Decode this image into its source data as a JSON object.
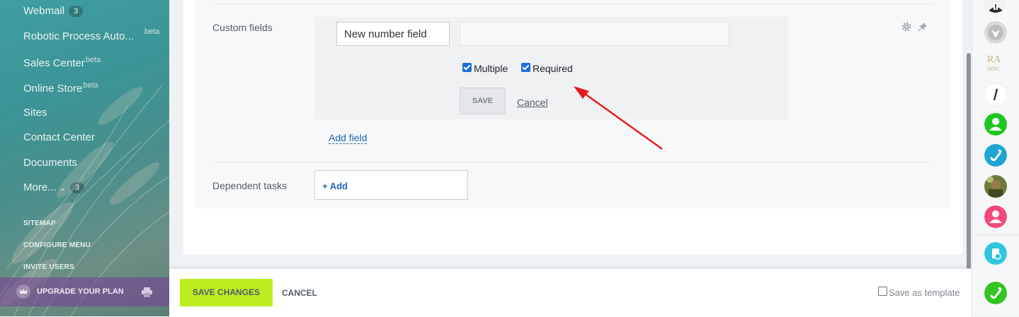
{
  "sidebar": {
    "items": [
      {
        "label": "Webmail",
        "counter": "3"
      },
      {
        "label": "Robotic Process Auto...",
        "badge": "beta"
      },
      {
        "label": "Sales Center",
        "badge": "beta"
      },
      {
        "label": "Online Store",
        "badge": "beta"
      },
      {
        "label": "Sites"
      },
      {
        "label": "Contact Center"
      },
      {
        "label": "Documents"
      },
      {
        "label": "More...",
        "counter": "3"
      }
    ],
    "small_links": [
      "SITEMAP",
      "CONFIGURE MENU",
      "INVITE USERS"
    ],
    "upgrade_label": "UPGRADE YOUR PLAN"
  },
  "form": {
    "custom_fields_label": "Custom fields",
    "field_name_value": "New number field",
    "field_value_value": "",
    "multiple_label": "Multiple",
    "multiple_checked": true,
    "required_label": "Required",
    "required_checked": true,
    "save_label": "SAVE",
    "cancel_label": "Cancel",
    "add_field_label": "Add field",
    "dependent_tasks_label": "Dependent tasks",
    "add_label": "+ Add"
  },
  "footer": {
    "save_changes_label": "SAVE CHANGES",
    "cancel_label": "CANCEL",
    "save_template_label": "Save as template",
    "save_template_checked": false
  },
  "right_panel": {
    "avatars": [
      "user-avatar-dark",
      "user-avatar-logo",
      "user-avatar-brand",
      "user-avatar-pen",
      "user-avatar-green",
      "phone-icon-blue",
      "user-avatar-photo",
      "user-avatar-pink",
      "cloud-icon-teal",
      "phone-icon-green"
    ]
  },
  "colors": {
    "accent_green": "#bbed21",
    "link_blue": "#2067b0",
    "checkbox_blue": "#1a6fdc",
    "arrow_red": "#e8181a"
  }
}
